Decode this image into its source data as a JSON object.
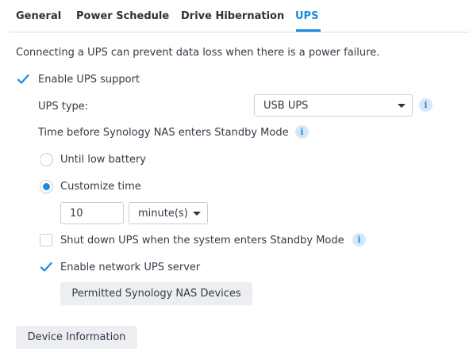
{
  "tabs": [
    {
      "label": "General",
      "active": false
    },
    {
      "label": "Power Schedule",
      "active": false
    },
    {
      "label": "Drive Hibernation",
      "active": false
    },
    {
      "label": "UPS",
      "active": true
    }
  ],
  "description": "Connecting a UPS can prevent data loss when there is a power failure.",
  "enable_ups": {
    "label": "Enable UPS support",
    "checked": true
  },
  "ups_type": {
    "label": "UPS type:",
    "selected": "USB UPS"
  },
  "standby": {
    "label": "Time before Synology NAS enters Standby Mode",
    "option_low_battery": "Until low battery",
    "option_customize": "Customize time",
    "time_value": "10",
    "time_unit": "minute(s)"
  },
  "shutdown_ups": {
    "label": "Shut down UPS when the system enters Standby Mode",
    "checked": false
  },
  "network_ups": {
    "label": "Enable network UPS server",
    "checked": true
  },
  "buttons": {
    "permitted_devices": "Permitted Synology NAS Devices",
    "device_information": "Device Information"
  },
  "icons": {
    "info": "i"
  },
  "colors": {
    "accent": "#1a8be0",
    "info_bg": "#d6e8f8",
    "button_bg": "#eceef1"
  }
}
